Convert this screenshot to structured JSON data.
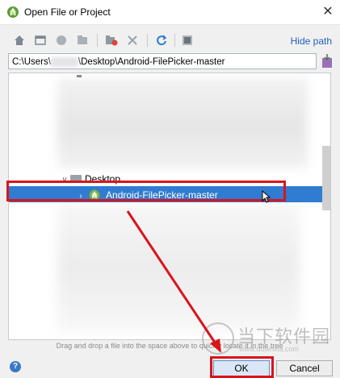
{
  "window": {
    "title": "Open File or Project",
    "close_glyph": "✕"
  },
  "toolbar": {
    "icons": [
      "home-icon",
      "desktop-icon",
      "project-icon",
      "module-icon",
      "new-folder-icon",
      "delete-icon",
      "refresh-icon",
      "show-hidden-icon"
    ],
    "hide_path_label": "Hide path"
  },
  "path": {
    "value_prefix": "C:\\Users\\",
    "value_suffix": "\\Desktop\\Android-FilePicker-master"
  },
  "tree": {
    "desktop_label": "Desktop",
    "selected_label": "Android-FilePicker-master",
    "expanded_glyph": "∨",
    "collapsed_glyph": "›"
  },
  "hint": {
    "text": "Drag and drop a file into the space above to quickly locate it in the tree"
  },
  "footer": {
    "help_glyph": "?",
    "ok_label": "OK",
    "cancel_label": "Cancel"
  },
  "watermark": {
    "title": "当下软件园",
    "url": "www.downxia.com"
  },
  "colors": {
    "selection": "#2f7cd2",
    "annotation": "#d9141c",
    "link": "#1f5fbf"
  }
}
